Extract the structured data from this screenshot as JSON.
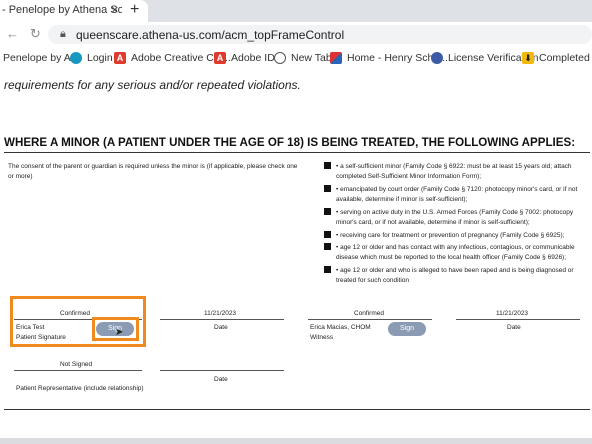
{
  "browser": {
    "tab_title": "- Penelope by Athena Softwa",
    "new_tab_symbol": "+",
    "close_symbol": "×",
    "url": "queenscare.athena-us.com/acm_topFrameControl",
    "bookmarks": [
      {
        "label": "Penelope by At...",
        "icon": "penelope-icon",
        "color": "#e8834a"
      },
      {
        "label": "Login",
        "icon": "salesforce-icon",
        "color": "#1798c1"
      },
      {
        "label": "Adobe Creative Clo...",
        "icon": "adobe-icon",
        "color": "#e03a2f"
      },
      {
        "label": "Adobe ID",
        "icon": "adobe-icon",
        "color": "#e03a2f"
      },
      {
        "label": "New Tab",
        "icon": "globe-icon",
        "color": "#555555"
      },
      {
        "label": "Home - Henry Sche...",
        "icon": "henry-schein-icon",
        "color": "#2b63b5"
      },
      {
        "label": "License Verification",
        "icon": "license-icon",
        "color": "#3b5ba7"
      },
      {
        "label": "Completed | Do",
        "icon": "download-icon",
        "color": "#f2b90c"
      }
    ]
  },
  "document": {
    "top_line": "requirements for any serious and/or repeated violations.",
    "section_heading": "WHERE A MINOR (A PATIENT UNDER THE AGE OF 18) IS BEING TREATED, THE FOLLOWING APPLIES:",
    "consent_text": "The consent of the parent or guardian is required unless the minor is (if applicable, please check one or more)",
    "options": [
      "• a self-sufficient minor (Family Code § 6922: must be at least 15 years old; attach completed Self-Sufficient Minor Information Form);",
      "• emancipated by court order (Family Code § 7120: photocopy minor's card, or if not available, determine if minor is self-sufficient);",
      "• serving on active duty in the U.S. Armed Forces (Family Code § 7002: photocopy minor's card, or if not available, determine if minor is self-sufficient);",
      "• receiving care for treatment or prevention of pregnancy (Family Code § 6925);",
      "• age 12 or older and has contact with any infectious, contagious, or communicable disease which must be reported to the local health officer (Family Code § 6926);",
      "• age 12 or older and who is alleged to have been raped and is being diagnosed or treated for such condition"
    ],
    "patient_sig": {
      "status": "Confirmed",
      "name": "Erica Test",
      "role": "Patient Signature",
      "button": "Sign"
    },
    "patient_date": {
      "value": "11/21/2023",
      "label": "Date"
    },
    "witness_sig": {
      "status": "Confirmed",
      "name": "Erica Macias, CHOM",
      "role": "Witness",
      "button": "Sign"
    },
    "witness_date": {
      "value": "11/21/2023",
      "label": "Date"
    },
    "rep_sig": {
      "status": "Not Signed",
      "role": "Patient Representative (include relationship)"
    },
    "rep_date": {
      "label": "Date"
    }
  },
  "colors": {
    "highlight": "#f08a1e",
    "sign_button": "#8a9bb3"
  }
}
